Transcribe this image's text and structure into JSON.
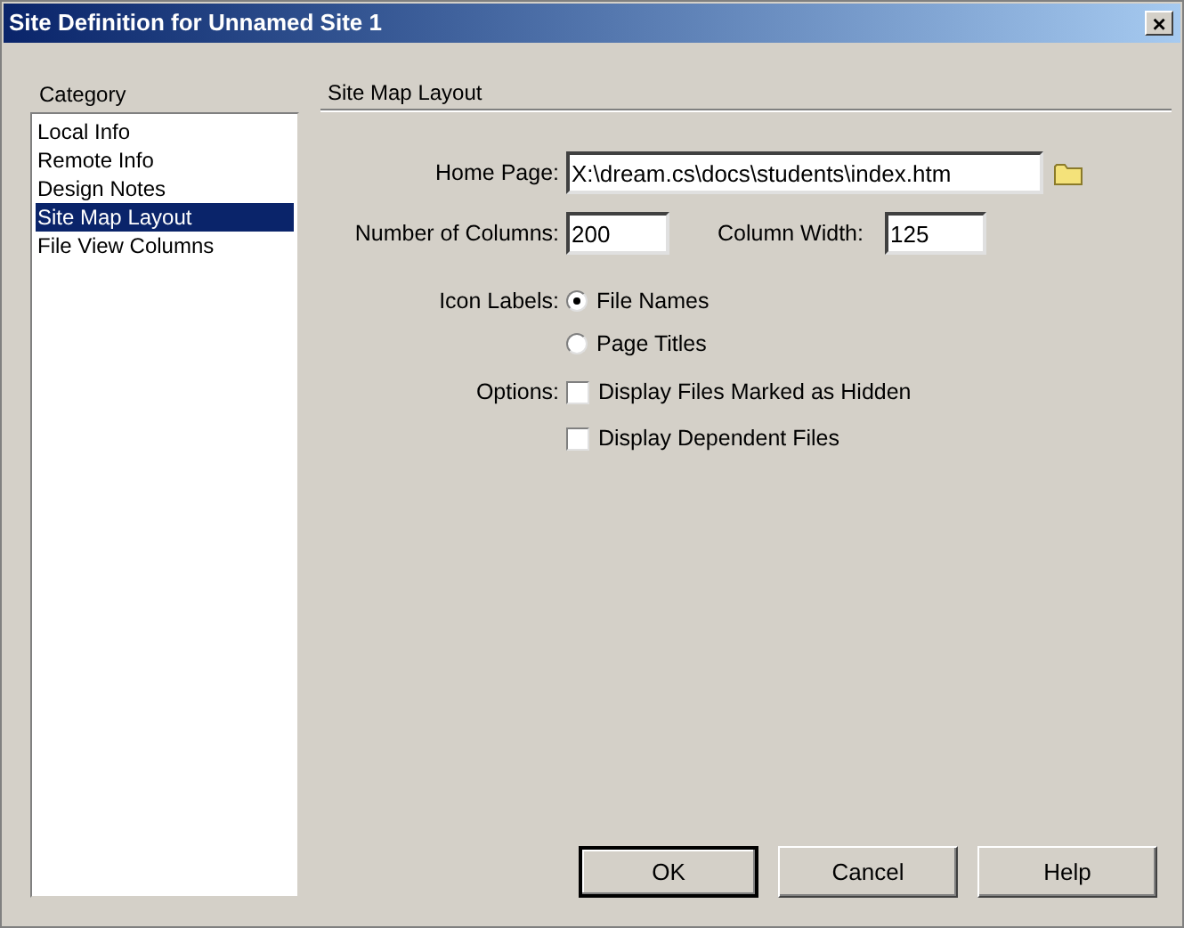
{
  "window": {
    "title": "Site Definition for Unnamed Site 1",
    "close": "×"
  },
  "category": {
    "label": "Category",
    "items": [
      {
        "label": "Local Info",
        "selected": false
      },
      {
        "label": "Remote Info",
        "selected": false
      },
      {
        "label": "Design Notes",
        "selected": false
      },
      {
        "label": "Site Map Layout",
        "selected": true
      },
      {
        "label": "File View Columns",
        "selected": false
      }
    ]
  },
  "panel": {
    "title": "Site Map Layout",
    "home_page": {
      "label": "Home Page:",
      "value": "X:\\dream.cs\\docs\\students\\index.htm"
    },
    "number_of_columns": {
      "label": "Number of Columns:",
      "value": "200"
    },
    "column_width": {
      "label": "Column Width:",
      "value": "125"
    },
    "icon_labels": {
      "label": "Icon Labels:",
      "options": [
        {
          "label": "File Names",
          "selected": true
        },
        {
          "label": "Page Titles",
          "selected": false
        }
      ]
    },
    "options": {
      "label": "Options:",
      "items": [
        {
          "label": "Display Files Marked as Hidden",
          "checked": false
        },
        {
          "label": "Display Dependent Files",
          "checked": false
        }
      ]
    }
  },
  "buttons": [
    {
      "label": "OK",
      "default": true
    },
    {
      "label": "Cancel",
      "default": false
    },
    {
      "label": "Help",
      "default": false
    }
  ]
}
